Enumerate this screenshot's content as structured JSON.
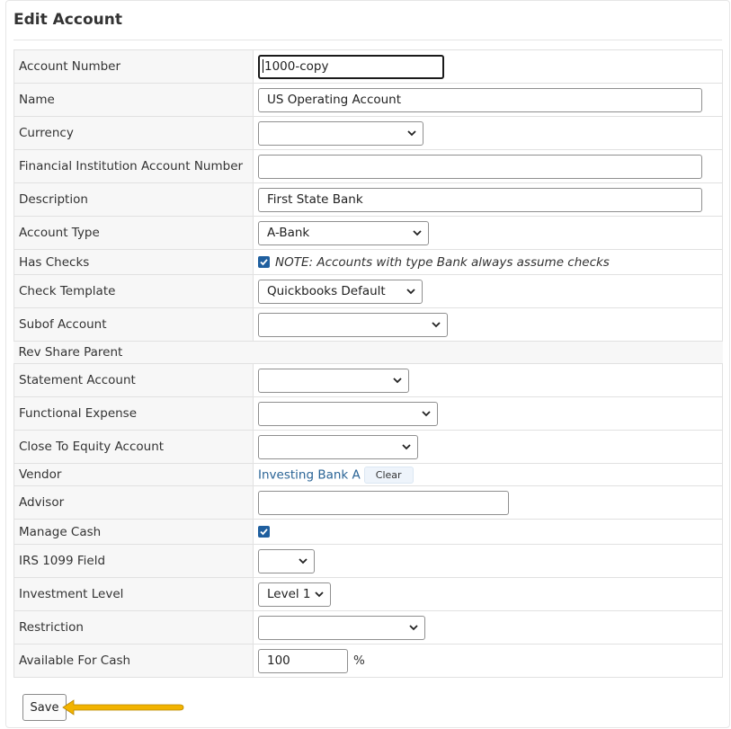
{
  "page_title": "Edit Account",
  "fields": {
    "account_number": {
      "label": "Account Number",
      "value": "1000-copy"
    },
    "name": {
      "label": "Name",
      "value": "US Operating Account"
    },
    "currency": {
      "label": "Currency",
      "value": ""
    },
    "fin_inst_account_number": {
      "label": "Financial Institution Account Number",
      "value": ""
    },
    "description": {
      "label": "Description",
      "value": "First State Bank"
    },
    "account_type": {
      "label": "Account Type",
      "value": "A-Bank"
    },
    "has_checks": {
      "label": "Has Checks",
      "checked": true,
      "note": "NOTE: Accounts with type Bank always assume checks"
    },
    "check_template": {
      "label": "Check Template",
      "value": "Quickbooks Default"
    },
    "subof_account": {
      "label": "Subof Account",
      "value": ""
    },
    "rev_share_parent": {
      "label": "Rev Share Parent"
    },
    "statement_account": {
      "label": "Statement Account",
      "value": ""
    },
    "functional_expense": {
      "label": "Functional Expense",
      "value": ""
    },
    "close_to_equity": {
      "label": "Close To Equity Account",
      "value": ""
    },
    "vendor": {
      "label": "Vendor",
      "value": "Investing Bank A",
      "clear_label": "Clear"
    },
    "advisor": {
      "label": "Advisor",
      "value": ""
    },
    "manage_cash": {
      "label": "Manage Cash",
      "checked": true
    },
    "irs_1099": {
      "label": "IRS 1099 Field",
      "value": ""
    },
    "investment_level": {
      "label": "Investment Level",
      "value": "Level 1"
    },
    "restriction": {
      "label": "Restriction",
      "value": ""
    },
    "available_for_cash": {
      "label": "Available For Cash",
      "value": "100",
      "unit": "%"
    }
  },
  "save_label": "Save",
  "colors": {
    "accent": "#1f5f9f",
    "link": "#2a6496",
    "arrow": "#f2b300"
  }
}
